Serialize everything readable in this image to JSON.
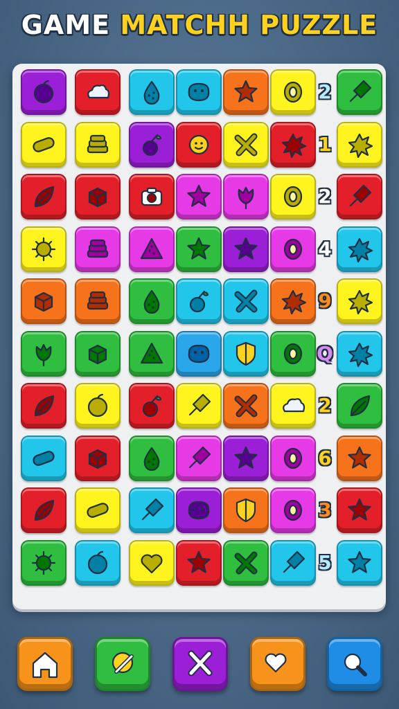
{
  "title": {
    "word1": "GAME",
    "word2": "MATCHH",
    "word3": "PUZZLE"
  },
  "colors": {
    "purple": "#9b1fd6",
    "red": "#e3202a",
    "cyan": "#22c6ea",
    "orange": "#f7731b",
    "yellow": "#fff41e",
    "green": "#2fbe3f",
    "magenta": "#e63ae6",
    "blue": "#2aa7ea"
  },
  "grid": [
    {
      "tiles": [
        {
          "color": "purple",
          "icon": "plum-icon"
        },
        {
          "color": "red",
          "icon": "cloud-icon"
        },
        {
          "color": "cyan",
          "icon": "drop-icon"
        },
        {
          "color": "cyan",
          "icon": "blob-face-icon"
        },
        {
          "color": "orange",
          "icon": "star-icon"
        },
        {
          "color": "yellow",
          "icon": "ring-icon"
        },
        {
          "color": "green",
          "icon": "popsicle-icon"
        }
      ],
      "number": "2",
      "number_color": "#b8eaff"
    },
    {
      "tiles": [
        {
          "color": "yellow",
          "icon": "pill-icon"
        },
        {
          "color": "yellow",
          "icon": "stack-icon"
        },
        {
          "color": "purple",
          "icon": "cherry-icon"
        },
        {
          "color": "red",
          "icon": "smiley-icon"
        },
        {
          "color": "yellow",
          "icon": "cross-icon"
        },
        {
          "color": "red",
          "icon": "splat-icon"
        },
        {
          "color": "yellow",
          "icon": "splat-icon"
        }
      ],
      "number": "1",
      "number_color": "#ffd21f"
    },
    {
      "tiles": [
        {
          "color": "red",
          "icon": "leaf-icon"
        },
        {
          "color": "red",
          "icon": "cube-icon"
        },
        {
          "color": "red",
          "icon": "camera-icon"
        },
        {
          "color": "magenta",
          "icon": "star-icon"
        },
        {
          "color": "magenta",
          "icon": "tulip-icon"
        },
        {
          "color": "yellow",
          "icon": "ring-icon"
        },
        {
          "color": "red",
          "icon": "popsicle-icon"
        }
      ],
      "number": "2",
      "number_color": "#ffffff"
    },
    {
      "tiles": [
        {
          "color": "yellow",
          "icon": "virus-icon"
        },
        {
          "color": "magenta",
          "icon": "stack-icon"
        },
        {
          "color": "magenta",
          "icon": "triangle-icon"
        },
        {
          "color": "green",
          "icon": "star-icon"
        },
        {
          "color": "purple",
          "icon": "star-icon"
        },
        {
          "color": "magenta",
          "icon": "ring-icon"
        },
        {
          "color": "cyan",
          "icon": "splat-icon"
        }
      ],
      "number": "4",
      "number_color": "#ffffff"
    },
    {
      "tiles": [
        {
          "color": "orange",
          "icon": "cube-icon"
        },
        {
          "color": "orange",
          "icon": "stack-icon"
        },
        {
          "color": "green",
          "icon": "drop-icon"
        },
        {
          "color": "cyan",
          "icon": "cherry-icon"
        },
        {
          "color": "cyan",
          "icon": "cross-icon"
        },
        {
          "color": "orange",
          "icon": "splat-icon"
        },
        {
          "color": "yellow",
          "icon": "splat-icon"
        }
      ],
      "number": "9",
      "number_color": "#ff8a1f"
    },
    {
      "tiles": [
        {
          "color": "green",
          "icon": "tulip-icon"
        },
        {
          "color": "green",
          "icon": "cube-icon"
        },
        {
          "color": "green",
          "icon": "triangle-icon"
        },
        {
          "color": "blue",
          "icon": "blob-face-icon"
        },
        {
          "color": "cyan",
          "icon": "shield-icon"
        },
        {
          "color": "green",
          "icon": "ring-icon"
        },
        {
          "color": "cyan",
          "icon": "splat-icon"
        }
      ],
      "number": "Q",
      "number_color": "#d58cf0"
    },
    {
      "tiles": [
        {
          "color": "red",
          "icon": "leaf-icon"
        },
        {
          "color": "yellow",
          "icon": "plum-icon"
        },
        {
          "color": "red",
          "icon": "cherry-icon"
        },
        {
          "color": "yellow",
          "icon": "popsicle-icon"
        },
        {
          "color": "orange",
          "icon": "cross-icon"
        },
        {
          "color": "yellow",
          "icon": "cloud-icon"
        },
        {
          "color": "green",
          "icon": "leaf-icon"
        }
      ],
      "number": "2",
      "number_color": "#ffd21f"
    },
    {
      "tiles": [
        {
          "color": "cyan",
          "icon": "pill-icon"
        },
        {
          "color": "red",
          "icon": "cube-icon"
        },
        {
          "color": "green",
          "icon": "drop-icon"
        },
        {
          "color": "magenta",
          "icon": "popsicle-icon"
        },
        {
          "color": "purple",
          "icon": "star-icon"
        },
        {
          "color": "magenta",
          "icon": "ring-icon"
        },
        {
          "color": "orange",
          "icon": "star-icon"
        }
      ],
      "number": "6",
      "number_color": "#ffd21f"
    },
    {
      "tiles": [
        {
          "color": "red",
          "icon": "leaf-icon"
        },
        {
          "color": "yellow",
          "icon": "pill-icon"
        },
        {
          "color": "cyan",
          "icon": "popsicle-icon"
        },
        {
          "color": "purple",
          "icon": "blob-face-icon"
        },
        {
          "color": "orange",
          "icon": "shield-icon"
        },
        {
          "color": "magenta",
          "icon": "ring-icon"
        },
        {
          "color": "red",
          "icon": "star-icon"
        }
      ],
      "number": "3",
      "number_color": "#ff8a1f"
    },
    {
      "tiles": [
        {
          "color": "green",
          "icon": "virus-icon"
        },
        {
          "color": "cyan",
          "icon": "plum-icon"
        },
        {
          "color": "yellow",
          "icon": "heart-icon"
        },
        {
          "color": "red",
          "icon": "star-icon"
        },
        {
          "color": "green",
          "icon": "cross-icon"
        },
        {
          "color": "cyan",
          "icon": "popsicle-icon"
        },
        {
          "color": "cyan",
          "icon": "star-icon"
        }
      ],
      "number": "5",
      "number_color": "#b8eaff"
    }
  ],
  "toolbar": [
    {
      "name": "home-button",
      "icon": "home-icon",
      "color": "#f7931b"
    },
    {
      "name": "hint-button",
      "icon": "magic-wand-icon",
      "color": "#2fbe3f"
    },
    {
      "name": "shuffle-button",
      "icon": "cross-swords-icon",
      "color": "#9b1fd6"
    },
    {
      "name": "lives-button",
      "icon": "heart-icon",
      "color": "#f7931b"
    },
    {
      "name": "search-button",
      "icon": "magnifier-icon",
      "color": "#1f8de6"
    }
  ]
}
